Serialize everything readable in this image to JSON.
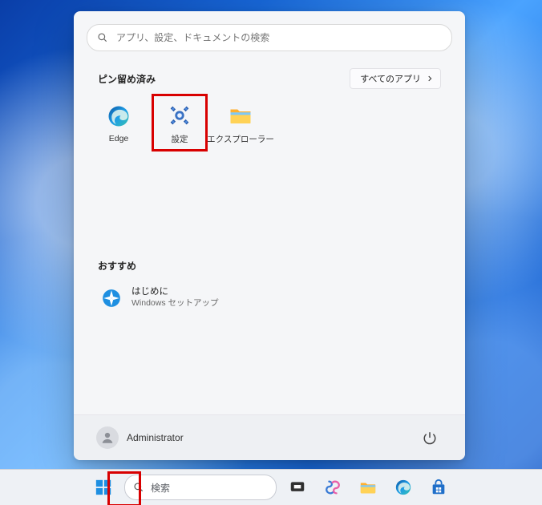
{
  "search": {
    "placeholder": "アプリ、設定、ドキュメントの検索"
  },
  "pinned": {
    "title": "ピン留め済み",
    "all_apps_label": "すべてのアプリ",
    "items": [
      {
        "label": "Edge",
        "icon": "edge-icon"
      },
      {
        "label": "設定",
        "icon": "settings-icon"
      },
      {
        "label": "エクスプローラー",
        "icon": "file-explorer-icon"
      }
    ]
  },
  "recommended": {
    "title": "おすすめ",
    "items": [
      {
        "title": "はじめに",
        "subtitle": "Windows セットアップ",
        "icon": "get-started-icon"
      }
    ]
  },
  "footer": {
    "username": "Administrator"
  },
  "taskbar": {
    "search_placeholder": "検索",
    "items": [
      {
        "name": "start-button",
        "icon": "windows-logo-icon"
      },
      {
        "name": "taskbar-search",
        "icon": "search-icon"
      },
      {
        "name": "task-view-button",
        "icon": "task-view-icon"
      },
      {
        "name": "copilot-button",
        "icon": "copilot-icon"
      },
      {
        "name": "file-explorer-task",
        "icon": "file-explorer-icon"
      },
      {
        "name": "edge-task",
        "icon": "edge-icon"
      },
      {
        "name": "store-task",
        "icon": "store-icon"
      }
    ]
  },
  "colors": {
    "highlight": "#d80000",
    "accent": "#1766d6"
  }
}
